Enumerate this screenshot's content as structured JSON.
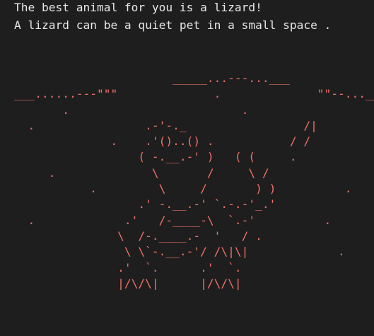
{
  "terminal": {
    "output_lines": [
      "The best animal for you is a lizard!",
      "A lizard can be a quiet pet in a small space ."
    ],
    "ascii_art": [
      "                       _____...---...___",
      "___......---\"\"\"              .              \"\"--..._____",
      "       .                         .                    .",
      "  .                .-'-._                 /|",
      "              .    .'()..() .           / /",
      "                  ( -.__.-' )   ( (     .",
      "     .              \\       /     \\ /",
      "           .         \\     /       ) )          .",
      "                  .' -.__.-' `.-.-'_.'",
      "  .             .'   /-____-\\  `.-'          .",
      "               \\  /-.____.-  '   / .",
      "                \\ \\`-.__.-'/ /\\|\\|             .",
      "               .'  `.      .'  `.",
      "               |/\\/\\|      |/\\/\\|"
    ],
    "colors": {
      "background": "#1e1e1e",
      "text": "#e8e8e8",
      "ascii_art": "#f07168"
    }
  }
}
